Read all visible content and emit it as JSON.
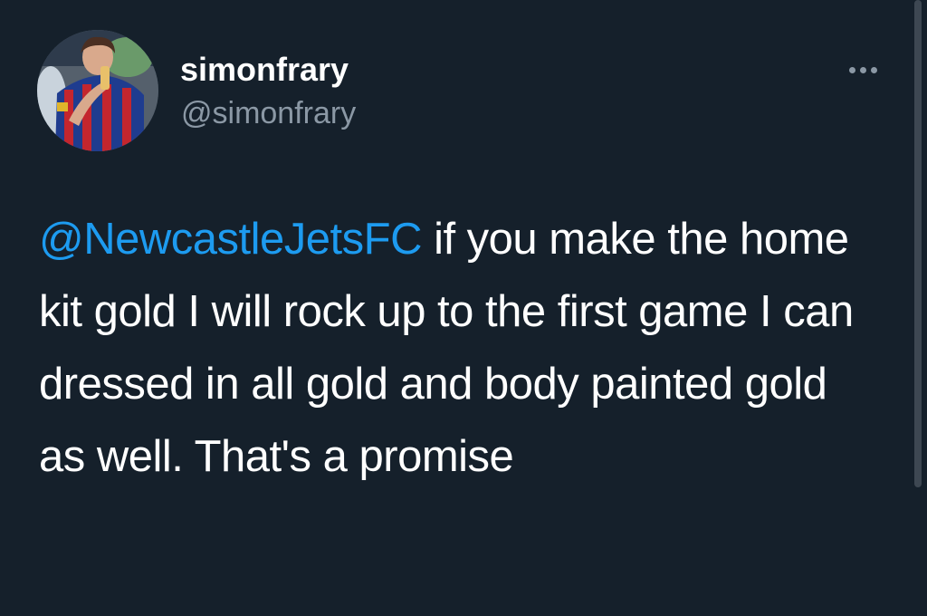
{
  "tweet": {
    "author": {
      "display_name": "simonfrary",
      "handle": "@simonfrary",
      "avatar": "profile-photo"
    },
    "more_icon": "more-horizontal-icon",
    "mention": "@NewcastleJetsFC",
    "text": " if you make the home kit gold I will rock up to the first game I can dressed in all gold and body painted gold as well. That's a promise"
  },
  "colors": {
    "background": "#15202b",
    "text": "#ffffff",
    "secondary_text": "#8b98a5",
    "link": "#1d9bf0"
  }
}
